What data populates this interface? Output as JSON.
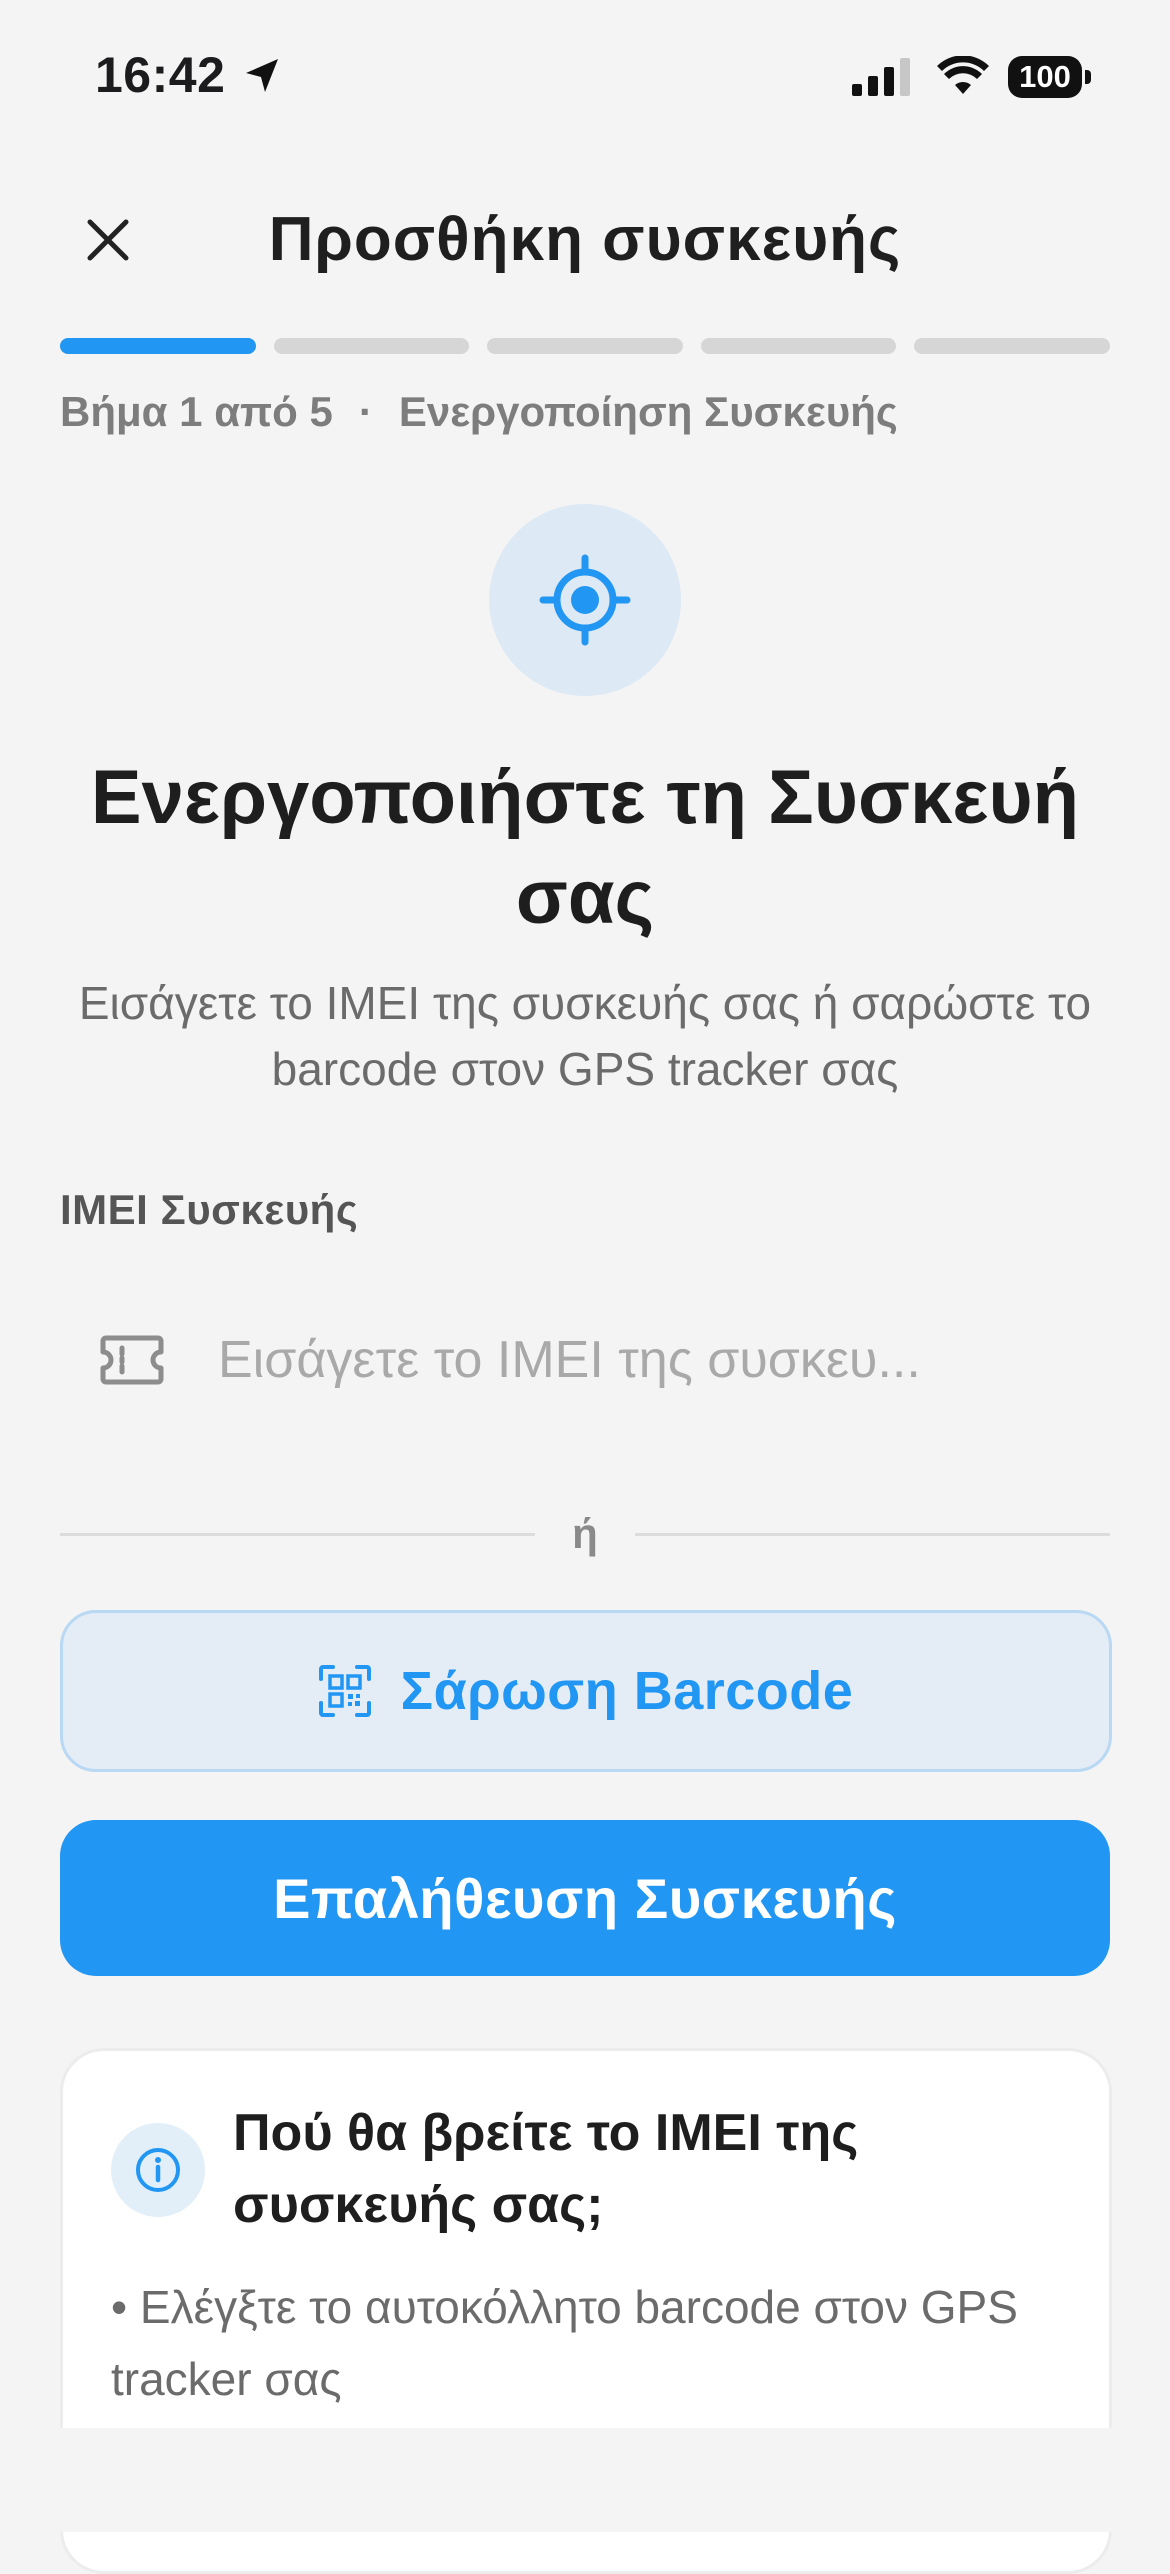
{
  "status_bar": {
    "time": "16:42",
    "battery": "100"
  },
  "header": {
    "title": "Προσθήκη συσκευής"
  },
  "progress": {
    "current_step": 1,
    "total_steps": 5,
    "step_text": "Βήμα 1 από 5",
    "separator": "·",
    "step_name": "Ενεργοποίηση Συσκευής",
    "active_color": "#2196f3"
  },
  "hero": {
    "icon": "gps-target-icon",
    "title": "Ενεργοποιήστε τη Συσκευή σας",
    "subtitle": "Εισάγετε το IMEI της συσκευής σας ή σαρώστε το barcode στον GPS tracker σας"
  },
  "imei": {
    "label": "IMEI Συσκευής",
    "value": "",
    "placeholder": "Εισάγετε το IMEI της συσκευ..."
  },
  "divider": {
    "text": "ή"
  },
  "buttons": {
    "scan_label": "Σάρωση Barcode",
    "verify_label": "Επαλήθευση Συσκευής"
  },
  "info_card": {
    "title": "Πού θα βρείτε το IMEI της συσκευής σας;",
    "tips": [
      "• Ελέγξτε το αυτοκόλλητο barcode στον GPS tracker σας"
    ]
  },
  "colors": {
    "accent": "#2196f3",
    "background": "#f4f4f4",
    "scan_bg": "#e4ecf5"
  }
}
